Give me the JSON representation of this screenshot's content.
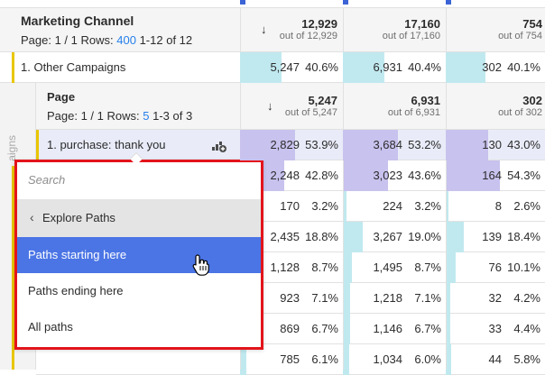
{
  "marketing_channel": {
    "title": "Marketing Channel",
    "page_text": "Page: 1 / 1 Rows:",
    "rows_value": "400",
    "range_text": "1-12 of 12",
    "totals": [
      {
        "value": "12,929",
        "out_of": "out of 12,929"
      },
      {
        "value": "17,160",
        "out_of": "out of 17,160"
      },
      {
        "value": "754",
        "out_of": "out of 754"
      }
    ]
  },
  "row_other_campaigns": {
    "label": "1.  Other Campaigns",
    "cells": [
      {
        "value": "5,247",
        "pct": "40.6%",
        "fill": 0.406
      },
      {
        "value": "6,931",
        "pct": "40.4%",
        "fill": 0.404
      },
      {
        "value": "302",
        "pct": "40.1%",
        "fill": 0.401
      }
    ]
  },
  "page_breakdown": {
    "title": "Page",
    "page_text": "Page: 1 / 1 Rows:",
    "rows_value": "5",
    "range_text": "1-3 of 3",
    "side_label": "aigns",
    "totals": [
      {
        "value": "5,247",
        "out_of": "out of 5,247"
      },
      {
        "value": "6,931",
        "out_of": "out of 6,931"
      },
      {
        "value": "302",
        "out_of": "out of 302"
      }
    ]
  },
  "row_purchase": {
    "label": "1.  purchase: thank you",
    "cells": [
      {
        "value": "2,829",
        "pct": "53.9%",
        "fill": 0.539
      },
      {
        "value": "3,684",
        "pct": "53.2%",
        "fill": 0.532
      },
      {
        "value": "130",
        "pct": "43.0%",
        "fill": 0.43
      }
    ]
  },
  "data_rows": [
    {
      "cells": [
        {
          "value": "2,248",
          "pct": "42.8%",
          "fill": 0.428,
          "style": "lavender"
        },
        {
          "value": "3,023",
          "pct": "43.6%",
          "fill": 0.436,
          "style": "lavender"
        },
        {
          "value": "164",
          "pct": "54.3%",
          "fill": 0.543,
          "style": "lavender"
        }
      ]
    },
    {
      "cells": [
        {
          "value": "170",
          "pct": "3.2%",
          "fill": 0.032,
          "style": "teal"
        },
        {
          "value": "224",
          "pct": "3.2%",
          "fill": 0.032,
          "style": "teal"
        },
        {
          "value": "8",
          "pct": "2.6%",
          "fill": 0.026,
          "style": "teal"
        }
      ]
    },
    {
      "cells": [
        {
          "value": "2,435",
          "pct": "18.8%",
          "fill": 0.188,
          "style": "teal"
        },
        {
          "value": "3,267",
          "pct": "19.0%",
          "fill": 0.19,
          "style": "teal"
        },
        {
          "value": "139",
          "pct": "18.4%",
          "fill": 0.184,
          "style": "teal"
        }
      ]
    },
    {
      "cells": [
        {
          "value": "1,128",
          "pct": "8.7%",
          "fill": 0.087,
          "style": "teal"
        },
        {
          "value": "1,495",
          "pct": "8.7%",
          "fill": 0.087,
          "style": "teal"
        },
        {
          "value": "76",
          "pct": "10.1%",
          "fill": 0.101,
          "style": "teal"
        }
      ]
    },
    {
      "cells": [
        {
          "value": "923",
          "pct": "7.1%",
          "fill": 0.071,
          "style": "teal"
        },
        {
          "value": "1,218",
          "pct": "7.1%",
          "fill": 0.071,
          "style": "teal"
        },
        {
          "value": "32",
          "pct": "4.2%",
          "fill": 0.042,
          "style": "teal"
        }
      ]
    },
    {
      "cells": [
        {
          "value": "869",
          "pct": "6.7%",
          "fill": 0.067,
          "style": "teal"
        },
        {
          "value": "1,146",
          "pct": "6.7%",
          "fill": 0.067,
          "style": "teal"
        },
        {
          "value": "33",
          "pct": "4.4%",
          "fill": 0.044,
          "style": "teal"
        }
      ]
    },
    {
      "cells": [
        {
          "value": "785",
          "pct": "6.1%",
          "fill": 0.061,
          "style": "teal"
        },
        {
          "value": "1,034",
          "pct": "6.0%",
          "fill": 0.06,
          "style": "teal"
        },
        {
          "value": "44",
          "pct": "5.8%",
          "fill": 0.058,
          "style": "teal"
        }
      ]
    }
  ],
  "context_menu": {
    "search_placeholder": "Search",
    "back_label": "Explore Paths",
    "items": [
      "Paths starting here",
      "Paths ending here",
      "All paths"
    ],
    "highlight_color": "#4b75e5",
    "frame_color": "#e3141b"
  },
  "colors": {
    "accent_blue": "#2680eb",
    "row_accent_yellow": "#e8c600",
    "bar_lavender": "#c8c2ee",
    "bar_teal": "#c0e9ef"
  }
}
